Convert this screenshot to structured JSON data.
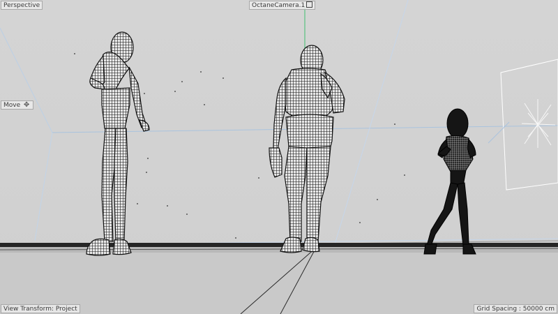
{
  "viewport": {
    "view_name": "Perspective",
    "camera_name": "OctaneCamera.1",
    "tool_name": "Move",
    "view_transform": "View Transform: Project",
    "grid_spacing": "Grid Spacing : 50000 cm"
  },
  "icons": {
    "camera_marker": "camera-target-icon",
    "move_arrows": "move-arrows-icon",
    "light": "light-star-icon"
  },
  "colors": {
    "background": "#d2d2d2",
    "wireframe": "#1a1a1a",
    "horizon": "#a9c3de",
    "camera_axis": "#3fbf6f"
  }
}
